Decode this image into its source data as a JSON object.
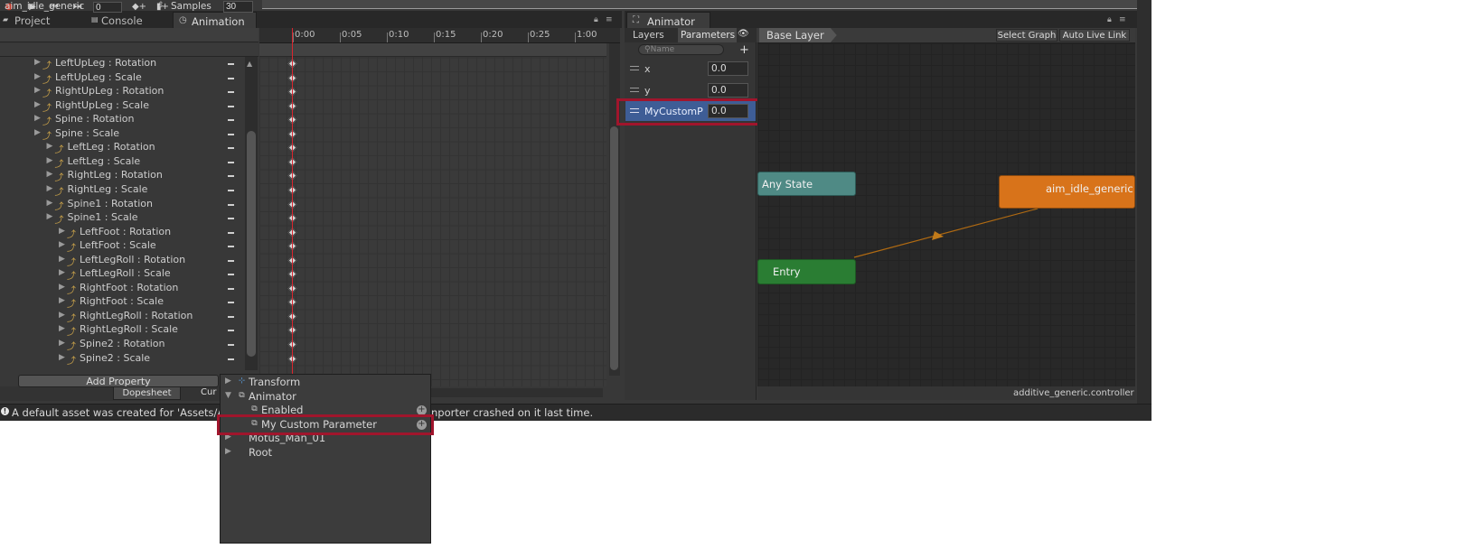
{
  "tabs": {
    "project": "Project",
    "console": "Console",
    "animation": "Animation",
    "animator": "Animator"
  },
  "animation": {
    "frame": "0",
    "clip_name": "aim_idle_generic",
    "samples_label": "Samples",
    "samples_value": "30",
    "ruler_labels": [
      "0:00",
      "0:05",
      "0:10",
      "0:15",
      "0:20",
      "0:25",
      "1:00"
    ],
    "properties": [
      "LeftUpLeg : Rotation",
      "LeftUpLeg : Scale",
      "RightUpLeg : Rotation",
      "RightUpLeg : Scale",
      "Spine : Rotation",
      "Spine : Scale",
      "LeftLeg : Rotation",
      "LeftLeg : Scale",
      "RightLeg : Rotation",
      "RightLeg : Scale",
      "Spine1 : Rotation",
      "Spine1 : Scale",
      "LeftFoot : Rotation",
      "LeftFoot : Scale",
      "LeftLegRoll : Rotation",
      "LeftLegRoll : Scale",
      "RightFoot : Rotation",
      "RightFoot : Scale",
      "RightLegRoll : Rotation",
      "RightLegRoll : Scale",
      "Spine2 : Rotation",
      "Spine2 : Scale"
    ],
    "property_depths": [
      0,
      0,
      0,
      0,
      0,
      0,
      1,
      1,
      1,
      1,
      1,
      1,
      2,
      2,
      2,
      2,
      2,
      2,
      2,
      2,
      2,
      2
    ],
    "add_property": "Add Property",
    "dopesheet_tab": "Dopesheet",
    "curves_tab": "Cur"
  },
  "animator": {
    "layers_tab": "Layers",
    "parameters_tab": "Parameters",
    "search_placeholder": "Name",
    "parameters": [
      {
        "name": "x",
        "value": "0.0"
      },
      {
        "name": "y",
        "value": "0.0"
      },
      {
        "name": "MyCustomP",
        "value": "0.0"
      }
    ],
    "breadcrumb": "Base Layer",
    "select_graph": "Select Graph",
    "auto_live_link": "Auto Live Link",
    "states": {
      "any_state": "Any State",
      "entry": "Entry",
      "default_state": "aim_idle_generic"
    },
    "controller_name": "additive_generic.controller"
  },
  "add_property_menu": {
    "items": [
      {
        "label": "Transform",
        "depth": 0,
        "expanded": false,
        "icon": "transform-icon"
      },
      {
        "label": "Animator",
        "depth": 0,
        "expanded": true,
        "icon": "animator-icon"
      },
      {
        "label": "Enabled",
        "depth": 1,
        "icon": "animator-icon",
        "add": true
      },
      {
        "label": "My Custom Parameter",
        "depth": 1,
        "icon": "animator-icon",
        "add": true
      },
      {
        "label": "Motus_Man_01",
        "depth": 0,
        "expanded": false
      },
      {
        "label": "Root",
        "depth": 0,
        "expanded": false
      }
    ]
  },
  "status": {
    "message": "A default asset was created for 'Assets/A",
    "message_tail": "nporter crashed on it last time."
  },
  "colors": {
    "highlight": "#a0152c",
    "any_state": "#4f8a85",
    "entry": "#2a7d33",
    "default_state": "#d8731a",
    "playhead": "#d9262f"
  }
}
